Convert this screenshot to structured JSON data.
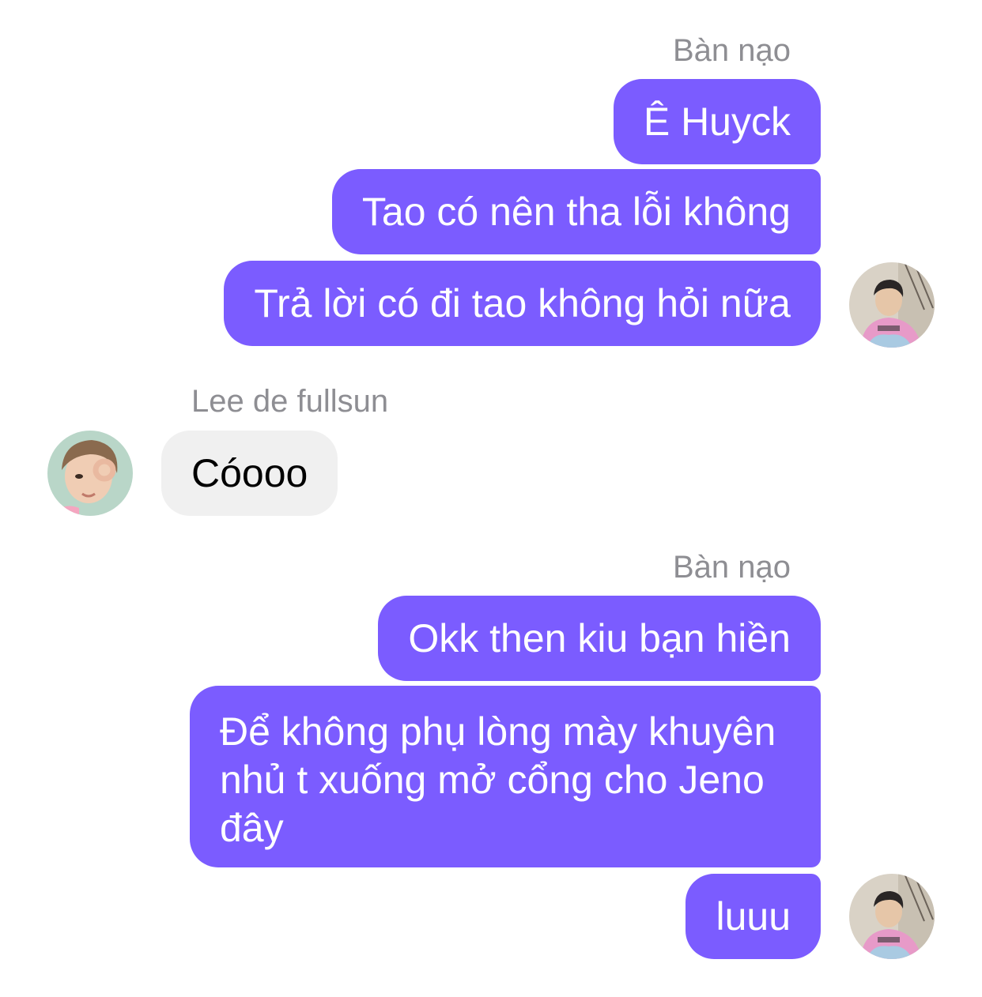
{
  "chat": {
    "groups": [
      {
        "sender": "Bàn nạo",
        "messages": [
          "Ê Huyck",
          "Tao có nên tha lỗi không",
          "Trả lời có đi tao không hỏi nữa"
        ]
      },
      {
        "sender": "Lee de fullsun",
        "messages": [
          "Cóooo"
        ]
      },
      {
        "sender": "Bàn nạo",
        "messages": [
          "Okk then kiu bạn hiền",
          "Để không phụ lòng mày khuyên nhủ t xuống mở cổng cho Jeno đây",
          "luuu"
        ]
      }
    ]
  },
  "colors": {
    "outgoing_bubble": "#7b5cff",
    "incoming_bubble": "#f0f0f0",
    "sender_name": "#8e8e93"
  }
}
